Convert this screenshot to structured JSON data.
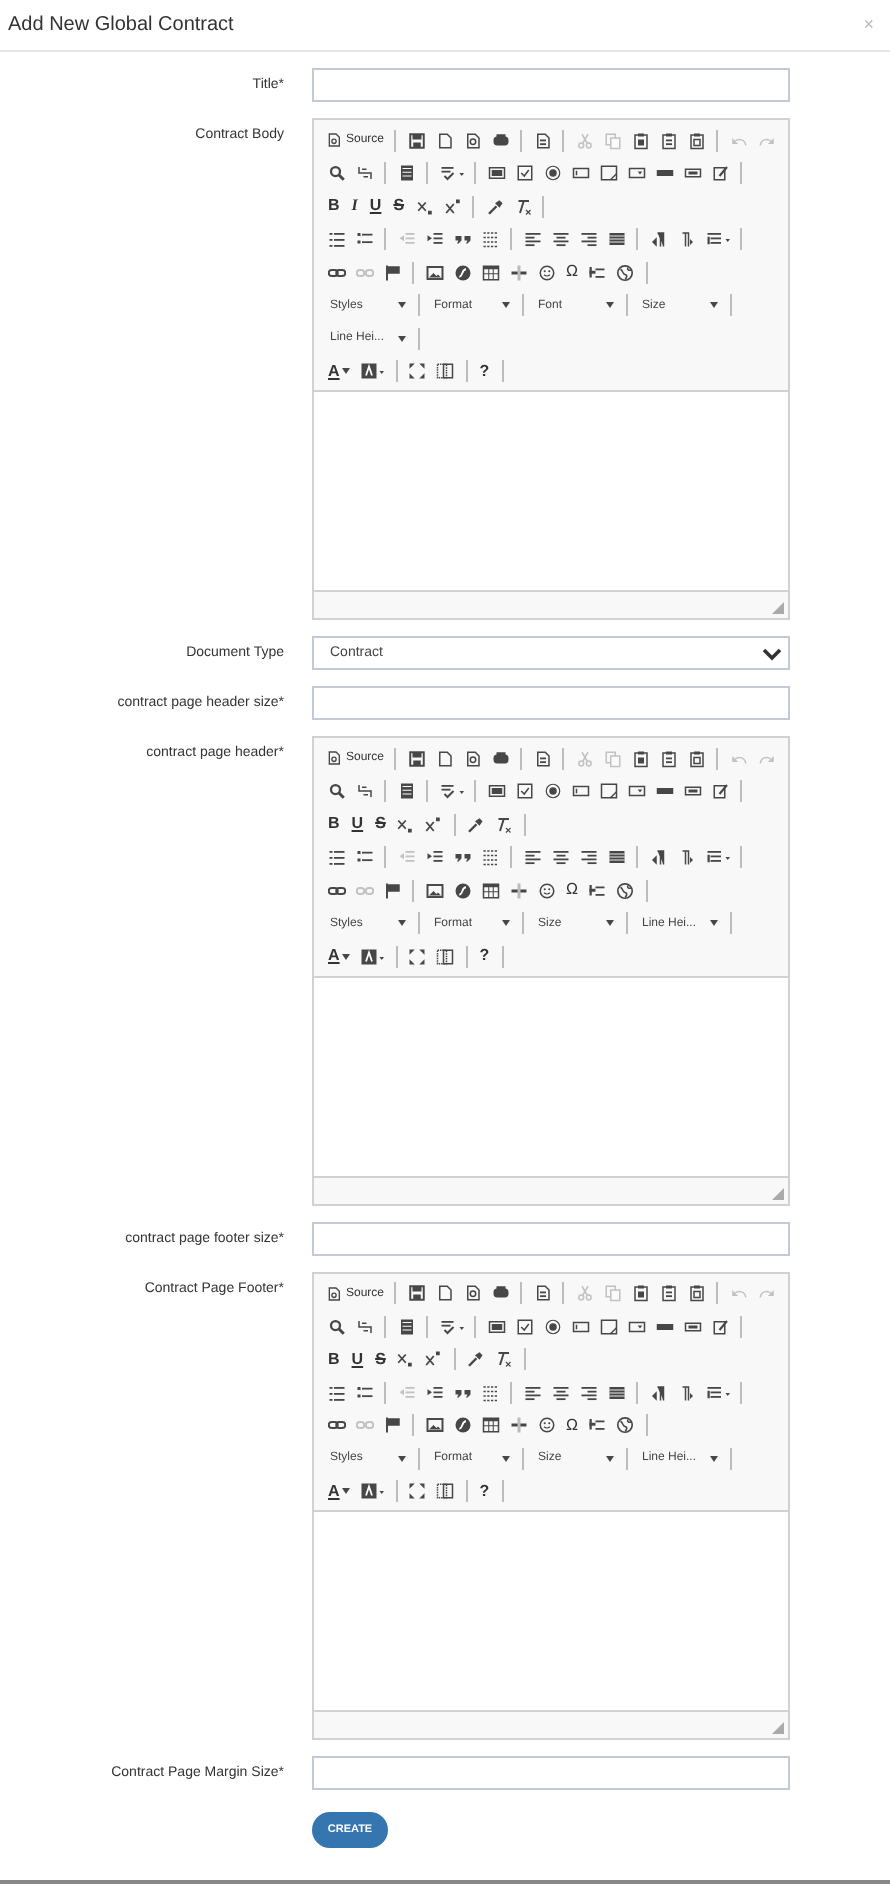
{
  "dialog": {
    "title": "Add New Global Contract",
    "close": "×"
  },
  "fields": [
    {
      "kind": "text",
      "label": "Title*"
    },
    {
      "kind": "editor",
      "label": "Contract Body",
      "toolbar": [
        [
          [
            {
              "kind": "source",
              "text": "Source",
              "disabled": false
            }
          ],
          [
            {
              "kind": "save",
              "disabled": false
            },
            {
              "kind": "newpage",
              "disabled": false
            },
            {
              "kind": "preview",
              "disabled": false
            },
            {
              "kind": "print",
              "disabled": false
            }
          ],
          [
            {
              "kind": "templates",
              "disabled": false
            }
          ],
          [
            {
              "kind": "cut",
              "disabled": true
            },
            {
              "kind": "copy",
              "disabled": true
            },
            {
              "kind": "paste",
              "disabled": false
            },
            {
              "kind": "pastetext",
              "disabled": false
            },
            {
              "kind": "pasteword",
              "disabled": false
            }
          ],
          [
            {
              "kind": "undo",
              "disabled": true
            },
            {
              "kind": "redo",
              "disabled": true
            }
          ]
        ],
        [
          [
            {
              "kind": "find",
              "disabled": false
            },
            {
              "kind": "replace",
              "disabled": false
            }
          ],
          [
            {
              "kind": "selectall",
              "disabled": false
            }
          ],
          [
            {
              "kind": "spellcheck",
              "disabled": false
            }
          ],
          [
            {
              "kind": "form",
              "disabled": false
            },
            {
              "kind": "checkbox",
              "disabled": false
            },
            {
              "kind": "radio",
              "disabled": false
            },
            {
              "kind": "textfield",
              "disabled": false
            },
            {
              "kind": "textarea",
              "disabled": false
            },
            {
              "kind": "select",
              "disabled": false
            },
            {
              "kind": "button",
              "disabled": false
            },
            {
              "kind": "imagebutton",
              "disabled": false
            },
            {
              "kind": "hiddenfield",
              "disabled": false
            }
          ]
        ],
        [
          [
            {
              "kind": "bold",
              "text": "B",
              "disabled": false
            },
            {
              "kind": "italic",
              "text": "I",
              "disabled": false
            },
            {
              "kind": "underline",
              "text": "U",
              "disabled": false
            },
            {
              "kind": "strike",
              "text": "S",
              "disabled": false
            },
            {
              "kind": "subscript",
              "disabled": false
            },
            {
              "kind": "superscript",
              "disabled": false
            }
          ],
          [
            {
              "kind": "copyformat",
              "disabled": false
            },
            {
              "kind": "removeformat",
              "disabled": false
            }
          ]
        ],
        [
          [
            {
              "kind": "numlist",
              "disabled": false
            },
            {
              "kind": "bullist",
              "disabled": false
            }
          ],
          [
            {
              "kind": "outdent",
              "disabled": true
            },
            {
              "kind": "indent",
              "disabled": false
            },
            {
              "kind": "blockquote",
              "disabled": false
            },
            {
              "kind": "creatediv",
              "disabled": false
            }
          ],
          [
            {
              "kind": "alignleft",
              "disabled": false
            },
            {
              "kind": "aligncenter",
              "disabled": false
            },
            {
              "kind": "alignright",
              "disabled": false
            },
            {
              "kind": "justify",
              "disabled": false
            }
          ],
          [
            {
              "kind": "ltr",
              "disabled": false
            },
            {
              "kind": "rtl",
              "disabled": false
            },
            {
              "kind": "language",
              "disabled": false
            }
          ]
        ],
        [
          [
            {
              "kind": "link",
              "disabled": false
            },
            {
              "kind": "unlink",
              "disabled": true
            },
            {
              "kind": "anchor",
              "disabled": false
            }
          ],
          [
            {
              "kind": "image",
              "disabled": false
            },
            {
              "kind": "flash",
              "disabled": false
            },
            {
              "kind": "table",
              "disabled": false
            },
            {
              "kind": "hr",
              "disabled": false
            },
            {
              "kind": "smiley",
              "disabled": false
            },
            {
              "kind": "specialchar",
              "text": "Ω",
              "disabled": false
            },
            {
              "kind": "pagebreak",
              "disabled": false
            },
            {
              "kind": "iframe",
              "disabled": false
            }
          ]
        ],
        [
          [
            {
              "kind": "combo",
              "text": "Styles",
              "disabled": false
            }
          ],
          [
            {
              "kind": "combo",
              "text": "Format",
              "disabled": false
            }
          ],
          [
            {
              "kind": "combo",
              "text": "Font",
              "disabled": false
            }
          ],
          [
            {
              "kind": "combo",
              "text": "Size",
              "disabled": false
            }
          ]
        ],
        [
          [
            {
              "kind": "combo",
              "text": "Line Hei...",
              "disabled": false
            }
          ]
        ],
        [
          [
            {
              "kind": "textcolor",
              "text": "A",
              "disabled": false
            },
            {
              "kind": "bgcolor",
              "disabled": false
            }
          ],
          [
            {
              "kind": "maximize",
              "disabled": false
            },
            {
              "kind": "showblocks",
              "disabled": false
            }
          ],
          [
            {
              "kind": "help",
              "text": "?",
              "disabled": false
            }
          ]
        ]
      ]
    },
    {
      "kind": "select",
      "label": "Document Type",
      "value": "Contract"
    },
    {
      "kind": "text",
      "label": "contract page header size*"
    },
    {
      "kind": "editor",
      "label": "contract page header*",
      "toolbar": [
        [
          [
            {
              "kind": "source",
              "text": "Source",
              "disabled": false
            }
          ],
          [
            {
              "kind": "save",
              "disabled": false
            },
            {
              "kind": "newpage",
              "disabled": false
            },
            {
              "kind": "preview",
              "disabled": false
            },
            {
              "kind": "print",
              "disabled": false
            }
          ],
          [
            {
              "kind": "templates",
              "disabled": false
            }
          ],
          [
            {
              "kind": "cut",
              "disabled": true
            },
            {
              "kind": "copy",
              "disabled": true
            },
            {
              "kind": "paste",
              "disabled": false
            },
            {
              "kind": "pastetext",
              "disabled": false
            },
            {
              "kind": "pasteword",
              "disabled": false
            }
          ],
          [
            {
              "kind": "undo",
              "disabled": true
            },
            {
              "kind": "redo",
              "disabled": true
            }
          ]
        ],
        [
          [
            {
              "kind": "find",
              "disabled": false
            },
            {
              "kind": "replace",
              "disabled": false
            }
          ],
          [
            {
              "kind": "selectall",
              "disabled": false
            }
          ],
          [
            {
              "kind": "spellcheck",
              "disabled": false
            }
          ],
          [
            {
              "kind": "form",
              "disabled": false
            },
            {
              "kind": "checkbox",
              "disabled": false
            },
            {
              "kind": "radio",
              "disabled": false
            },
            {
              "kind": "textfield",
              "disabled": false
            },
            {
              "kind": "textarea",
              "disabled": false
            },
            {
              "kind": "select",
              "disabled": false
            },
            {
              "kind": "button",
              "disabled": false
            },
            {
              "kind": "imagebutton",
              "disabled": false
            },
            {
              "kind": "hiddenfield",
              "disabled": false
            }
          ]
        ],
        [
          [
            {
              "kind": "bold",
              "text": "B",
              "disabled": false
            },
            {
              "kind": "underline",
              "text": "U",
              "disabled": false
            },
            {
              "kind": "strike",
              "text": "S",
              "disabled": false
            },
            {
              "kind": "subscript",
              "disabled": false
            },
            {
              "kind": "superscript",
              "disabled": false
            }
          ],
          [
            {
              "kind": "copyformat",
              "disabled": false
            },
            {
              "kind": "removeformat",
              "disabled": false
            }
          ]
        ],
        [
          [
            {
              "kind": "numlist",
              "disabled": false
            },
            {
              "kind": "bullist",
              "disabled": false
            }
          ],
          [
            {
              "kind": "outdent",
              "disabled": true
            },
            {
              "kind": "indent",
              "disabled": false
            },
            {
              "kind": "blockquote",
              "disabled": false
            },
            {
              "kind": "creatediv",
              "disabled": false
            }
          ],
          [
            {
              "kind": "alignleft",
              "disabled": false
            },
            {
              "kind": "aligncenter",
              "disabled": false
            },
            {
              "kind": "alignright",
              "disabled": false
            },
            {
              "kind": "justify",
              "disabled": false
            }
          ],
          [
            {
              "kind": "ltr",
              "disabled": false
            },
            {
              "kind": "rtl",
              "disabled": false
            },
            {
              "kind": "language",
              "disabled": false
            }
          ]
        ],
        [
          [
            {
              "kind": "link",
              "disabled": false
            },
            {
              "kind": "unlink",
              "disabled": true
            },
            {
              "kind": "anchor",
              "disabled": false
            }
          ],
          [
            {
              "kind": "image",
              "disabled": false
            },
            {
              "kind": "flash",
              "disabled": false
            },
            {
              "kind": "table",
              "disabled": false
            },
            {
              "kind": "hr",
              "disabled": false
            },
            {
              "kind": "smiley",
              "disabled": false
            },
            {
              "kind": "specialchar",
              "text": "Ω",
              "disabled": false
            },
            {
              "kind": "pagebreak",
              "disabled": false
            },
            {
              "kind": "iframe",
              "disabled": false
            }
          ]
        ],
        [
          [
            {
              "kind": "combo",
              "text": "Styles",
              "disabled": false
            }
          ],
          [
            {
              "kind": "combo",
              "text": "Format",
              "disabled": false
            }
          ],
          [
            {
              "kind": "combo",
              "text": "Size",
              "disabled": false
            }
          ],
          [
            {
              "kind": "combo",
              "text": "Line Hei...",
              "disabled": false
            }
          ]
        ],
        [
          [
            {
              "kind": "textcolor",
              "text": "A",
              "disabled": false
            },
            {
              "kind": "bgcolor",
              "disabled": false
            }
          ],
          [
            {
              "kind": "maximize",
              "disabled": false
            },
            {
              "kind": "showblocks",
              "disabled": false
            }
          ],
          [
            {
              "kind": "help",
              "text": "?",
              "disabled": false
            }
          ]
        ]
      ]
    },
    {
      "kind": "text",
      "label": "contract page footer size*"
    },
    {
      "kind": "editor",
      "label": "Contract Page Footer*",
      "toolbar": [
        [
          [
            {
              "kind": "source",
              "text": "Source",
              "disabled": false
            }
          ],
          [
            {
              "kind": "save",
              "disabled": false
            },
            {
              "kind": "newpage",
              "disabled": false
            },
            {
              "kind": "preview",
              "disabled": false
            },
            {
              "kind": "print",
              "disabled": false
            }
          ],
          [
            {
              "kind": "templates",
              "disabled": false
            }
          ],
          [
            {
              "kind": "cut",
              "disabled": true
            },
            {
              "kind": "copy",
              "disabled": true
            },
            {
              "kind": "paste",
              "disabled": false
            },
            {
              "kind": "pastetext",
              "disabled": false
            },
            {
              "kind": "pasteword",
              "disabled": false
            }
          ],
          [
            {
              "kind": "undo",
              "disabled": true
            },
            {
              "kind": "redo",
              "disabled": true
            }
          ]
        ],
        [
          [
            {
              "kind": "find",
              "disabled": false
            },
            {
              "kind": "replace",
              "disabled": false
            }
          ],
          [
            {
              "kind": "selectall",
              "disabled": false
            }
          ],
          [
            {
              "kind": "spellcheck",
              "disabled": false
            }
          ],
          [
            {
              "kind": "form",
              "disabled": false
            },
            {
              "kind": "checkbox",
              "disabled": false
            },
            {
              "kind": "radio",
              "disabled": false
            },
            {
              "kind": "textfield",
              "disabled": false
            },
            {
              "kind": "textarea",
              "disabled": false
            },
            {
              "kind": "select",
              "disabled": false
            },
            {
              "kind": "button",
              "disabled": false
            },
            {
              "kind": "imagebutton",
              "disabled": false
            },
            {
              "kind": "hiddenfield",
              "disabled": false
            }
          ]
        ],
        [
          [
            {
              "kind": "bold",
              "text": "B",
              "disabled": false
            },
            {
              "kind": "underline",
              "text": "U",
              "disabled": false
            },
            {
              "kind": "strike",
              "text": "S",
              "disabled": false
            },
            {
              "kind": "subscript",
              "disabled": false
            },
            {
              "kind": "superscript",
              "disabled": false
            }
          ],
          [
            {
              "kind": "copyformat",
              "disabled": false
            },
            {
              "kind": "removeformat",
              "disabled": false
            }
          ]
        ],
        [
          [
            {
              "kind": "numlist",
              "disabled": false
            },
            {
              "kind": "bullist",
              "disabled": false
            }
          ],
          [
            {
              "kind": "outdent",
              "disabled": true
            },
            {
              "kind": "indent",
              "disabled": false
            },
            {
              "kind": "blockquote",
              "disabled": false
            },
            {
              "kind": "creatediv",
              "disabled": false
            }
          ],
          [
            {
              "kind": "alignleft",
              "disabled": false
            },
            {
              "kind": "aligncenter",
              "disabled": false
            },
            {
              "kind": "alignright",
              "disabled": false
            },
            {
              "kind": "justify",
              "disabled": false
            }
          ],
          [
            {
              "kind": "ltr",
              "disabled": false
            },
            {
              "kind": "rtl",
              "disabled": false
            },
            {
              "kind": "language",
              "disabled": false
            }
          ]
        ],
        [
          [
            {
              "kind": "link",
              "disabled": false
            },
            {
              "kind": "unlink",
              "disabled": true
            },
            {
              "kind": "anchor",
              "disabled": false
            }
          ],
          [
            {
              "kind": "image",
              "disabled": false
            },
            {
              "kind": "flash",
              "disabled": false
            },
            {
              "kind": "table",
              "disabled": false
            },
            {
              "kind": "hr",
              "disabled": false
            },
            {
              "kind": "smiley",
              "disabled": false
            },
            {
              "kind": "specialchar",
              "text": "Ω",
              "disabled": false
            },
            {
              "kind": "pagebreak",
              "disabled": false
            },
            {
              "kind": "iframe",
              "disabled": false
            }
          ]
        ],
        [
          [
            {
              "kind": "combo",
              "text": "Styles",
              "disabled": false
            }
          ],
          [
            {
              "kind": "combo",
              "text": "Format",
              "disabled": false
            }
          ],
          [
            {
              "kind": "combo",
              "text": "Size",
              "disabled": false
            }
          ],
          [
            {
              "kind": "combo",
              "text": "Line Hei...",
              "disabled": false
            }
          ]
        ],
        [
          [
            {
              "kind": "textcolor",
              "text": "A",
              "disabled": false
            },
            {
              "kind": "bgcolor",
              "disabled": false
            }
          ],
          [
            {
              "kind": "maximize",
              "disabled": false
            },
            {
              "kind": "showblocks",
              "disabled": false
            }
          ],
          [
            {
              "kind": "help",
              "text": "?",
              "disabled": false
            }
          ]
        ]
      ]
    },
    {
      "kind": "text",
      "label": "Contract Page Margin Size*"
    }
  ],
  "submit": {
    "label": "CREATE"
  }
}
